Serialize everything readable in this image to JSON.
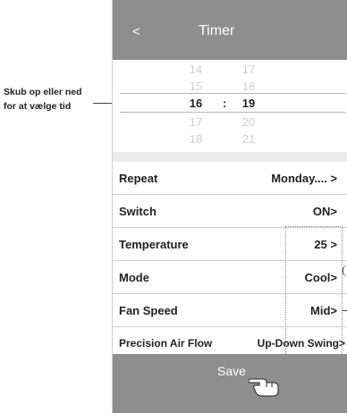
{
  "callout": {
    "line1": "Skub op eller ned",
    "line2": "for at vælge tid"
  },
  "header": {
    "back": "<",
    "title": "Timer"
  },
  "picker": {
    "hours": [
      "14",
      "15",
      "16",
      "17",
      "18"
    ],
    "minutes": [
      "17",
      "18",
      "19",
      "20",
      "21"
    ],
    "separator": ":",
    "selected_hour": "16",
    "selected_minute": "19"
  },
  "settings": [
    {
      "label": "Repeat",
      "value": "Monday.... >"
    },
    {
      "label": "Switch",
      "value": "ON>"
    },
    {
      "label": "Temperature",
      "value": "25  >"
    },
    {
      "label": "Mode",
      "value": "Cool>"
    },
    {
      "label": "Fan Speed",
      "value": "Mid>"
    },
    {
      "label": "Precision Air Flow",
      "value": "Up-Down Swing>"
    }
  ],
  "save": {
    "label": "Save"
  },
  "icons": {
    "back": "chevron-left-icon",
    "pointer": "hand-pointer-icon"
  }
}
